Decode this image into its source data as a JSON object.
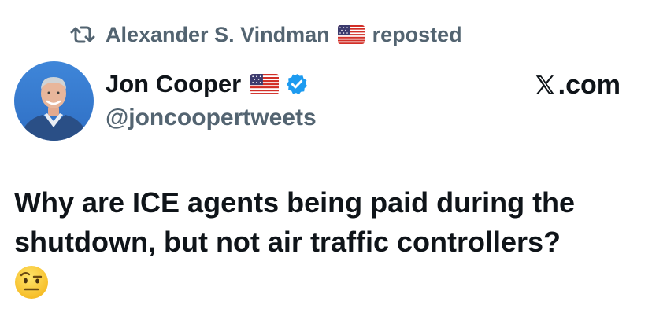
{
  "repost": {
    "icon": "repost-icon",
    "user": "Alexander S. Vindman",
    "flag": "us-flag-icon",
    "label": "reposted"
  },
  "author": {
    "avatar": "avatar",
    "name": "Jon Cooper",
    "flag": "us-flag-icon",
    "verified_icon": "verified-badge-icon",
    "handle": "@joncoopertweets"
  },
  "brand": {
    "logo": "x-logo-icon",
    "suffix": ".com"
  },
  "tweet": {
    "text": "Why are ICE agents being paid during the shutdown, but not air traffic controllers?",
    "emoji": "face-with-raised-eyebrow-icon"
  },
  "colors": {
    "text_primary": "#0f1419",
    "text_secondary": "#536471",
    "verified_blue": "#1d9bf0"
  }
}
